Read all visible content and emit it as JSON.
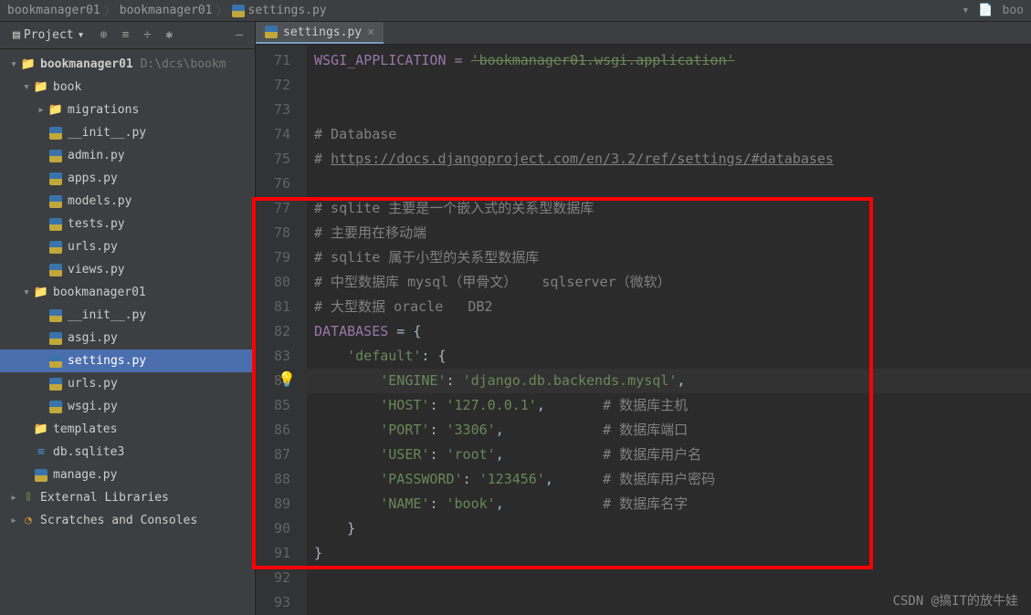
{
  "breadcrumb": {
    "root": "bookmanager01",
    "sub": "bookmanager01",
    "file": "settings.py"
  },
  "topbar": {
    "right": "boo"
  },
  "sidebar": {
    "project_label": "Project",
    "root": {
      "name": "bookmanager01",
      "path": "D:\\dcs\\bookm"
    },
    "book": {
      "name": "book",
      "migrations": "migrations",
      "files": [
        "__init__.py",
        "admin.py",
        "apps.py",
        "models.py",
        "tests.py",
        "urls.py",
        "views.py"
      ]
    },
    "bm01": {
      "name": "bookmanager01",
      "files": [
        "__init__.py",
        "asgi.py",
        "settings.py",
        "urls.py",
        "wsgi.py"
      ]
    },
    "templates": "templates",
    "dbfile": "db.sqlite3",
    "manage": "manage.py",
    "external": "External Libraries",
    "scratches": "Scratches and Consoles"
  },
  "tab": {
    "name": "settings.py"
  },
  "code": {
    "line71": {
      "pre": "WSGI_APPLICATION = ",
      "val": "'bookmanager01.wsgi.application'"
    },
    "line74": "# Database",
    "line75": {
      "pre": "# ",
      "link": "https://docs.djangoproject.com/en/3.2/ref/settings/#databases"
    },
    "line77": "# sqlite 主要是一个嵌入式的关系型数据库",
    "line78": "# 主要用在移动端",
    "line79": "# sqlite 属于小型的关系型数据库",
    "line80": "# 中型数据库 mysql（甲骨文）   sqlserver（微软）",
    "line81": "# 大型数据 oracle   DB2",
    "line82": {
      "id": "DATABASES",
      "rest": " = {"
    },
    "line83": {
      "key": "'default'",
      "rest": ": {"
    },
    "line84": {
      "key": "'ENGINE'",
      "sep": ": ",
      "val": "'django.db.backends.mysql'",
      "tail": ","
    },
    "line85": {
      "key": "'HOST'",
      "sep": ": ",
      "val": "'127.0.0.1'",
      "tail": ",",
      "cm": "# 数据库主机"
    },
    "line86": {
      "key": "'PORT'",
      "sep": ": ",
      "val": "'3306'",
      "tail": ",",
      "cm": "# 数据库端口"
    },
    "line87": {
      "key": "'USER'",
      "sep": ": ",
      "val": "'root'",
      "tail": ",",
      "cm": "# 数据库用户名"
    },
    "line88": {
      "key": "'PASSWORD'",
      "sep": ": ",
      "val": "'123456'",
      "tail": ",",
      "cm": "# 数据库用户密码"
    },
    "line89": {
      "key": "'NAME'",
      "sep": ": ",
      "val": "'book'",
      "tail": ",",
      "cm": "# 数据库名字"
    },
    "line90": "    }",
    "line91": "}"
  },
  "line_numbers": [
    "71",
    "72",
    "73",
    "74",
    "75",
    "76",
    "77",
    "78",
    "79",
    "80",
    "81",
    "82",
    "83",
    "84",
    "85",
    "86",
    "87",
    "88",
    "89",
    "90",
    "91",
    "92",
    "93"
  ],
  "watermark": "CSDN @搞IT的放牛娃"
}
